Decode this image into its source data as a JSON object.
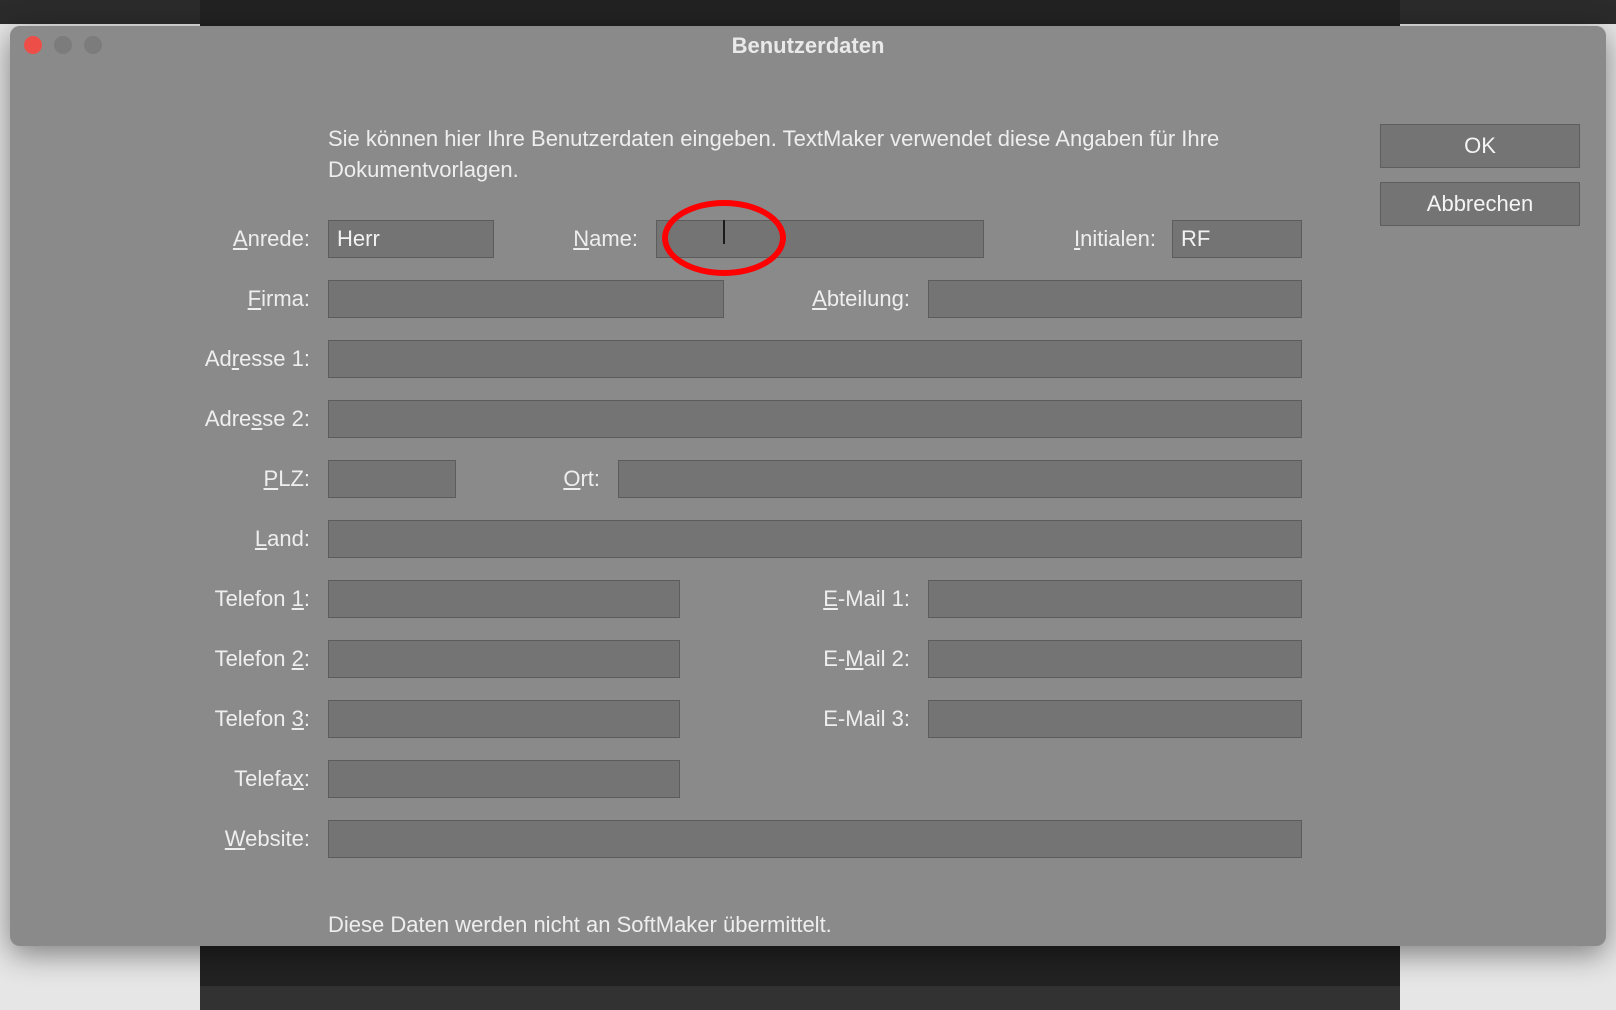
{
  "window": {
    "title": "Benutzerdaten"
  },
  "intro": "Sie können hier Ihre Benutzerdaten eingeben. TextMaker verwendet diese Angaben für Ihre Dokumentvorlagen.",
  "labels": {
    "anrede": {
      "pre": "",
      "u": "A",
      "post": "nrede:"
    },
    "name": {
      "pre": "",
      "u": "N",
      "post": "ame:"
    },
    "initialen": {
      "pre": "",
      "u": "I",
      "post": "nitialen:"
    },
    "firma": {
      "pre": "",
      "u": "F",
      "post": "irma:"
    },
    "abteilung": {
      "pre": "",
      "u": "A",
      "post": "bteilung:"
    },
    "adresse1": {
      "pre": "Ad",
      "u": "r",
      "post": "esse 1:"
    },
    "adresse2": {
      "pre": "Adre",
      "u": "s",
      "post": "se 2:"
    },
    "plz": {
      "pre": "",
      "u": "P",
      "post": "LZ:"
    },
    "ort": {
      "pre": "",
      "u": "O",
      "post": "rt:"
    },
    "land": {
      "pre": "",
      "u": "L",
      "post": "and:"
    },
    "tel1": {
      "pre": "Telefon ",
      "u": "1",
      "post": ":"
    },
    "tel2": {
      "pre": "Telefon ",
      "u": "2",
      "post": ":"
    },
    "tel3": {
      "pre": "Telefon ",
      "u": "3",
      "post": ":"
    },
    "email1": {
      "pre": "",
      "u": "E",
      "post": "-Mail 1:"
    },
    "email2": {
      "pre": "E-",
      "u": "M",
      "post": "ail 2:"
    },
    "email3": {
      "pre": "E-Mail 3:",
      "u": "",
      "post": ""
    },
    "telefax": {
      "pre": "Telefa",
      "u": "x",
      "post": ":"
    },
    "website": {
      "pre": "",
      "u": "W",
      "post": "ebsite:"
    }
  },
  "values": {
    "anrede": "Herr",
    "name": "",
    "initialen": "RF",
    "firma": "",
    "abteilung": "",
    "adresse1": "",
    "adresse2": "",
    "plz": "",
    "ort": "",
    "land": "",
    "tel1": "",
    "tel2": "",
    "tel3": "",
    "email1": "",
    "email2": "",
    "email3": "",
    "telefax": "",
    "website": ""
  },
  "footer": "Diese Daten werden nicht an SoftMaker übermittelt.",
  "buttons": {
    "ok": "OK",
    "cancel": "Abbrechen"
  }
}
